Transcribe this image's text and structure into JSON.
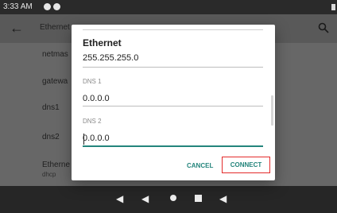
{
  "status_bar": {
    "time": "3:33 AM"
  },
  "app_bar": {
    "title": "Ethernet"
  },
  "background_list": {
    "items": [
      "netmas",
      "gatewa",
      "dns1",
      "dns2",
      "Etherne"
    ],
    "subtext": "dhcp"
  },
  "dialog": {
    "title": "Ethernet",
    "fields": [
      {
        "label": "",
        "value": "255.255.255.0"
      },
      {
        "label": "DNS 1",
        "value": "0.0.0.0"
      },
      {
        "label": "DNS 2",
        "value": "0.0.0.0"
      }
    ],
    "buttons": {
      "cancel": "CANCEL",
      "connect": "CONNECT"
    }
  },
  "icons": {
    "status": [
      "status-icon-1",
      "status-icon-2"
    ],
    "back": "arrow-back-icon",
    "search": "search-icon",
    "nav": [
      "volume-down-icon",
      "back-icon",
      "home-icon",
      "recent-apps-icon",
      "volume-up-icon"
    ]
  },
  "colors": {
    "accent": "#24857c",
    "highlight_border": "#e32b2b",
    "dialog_bg": "#ffffff",
    "overlay_bg": "#676767"
  }
}
